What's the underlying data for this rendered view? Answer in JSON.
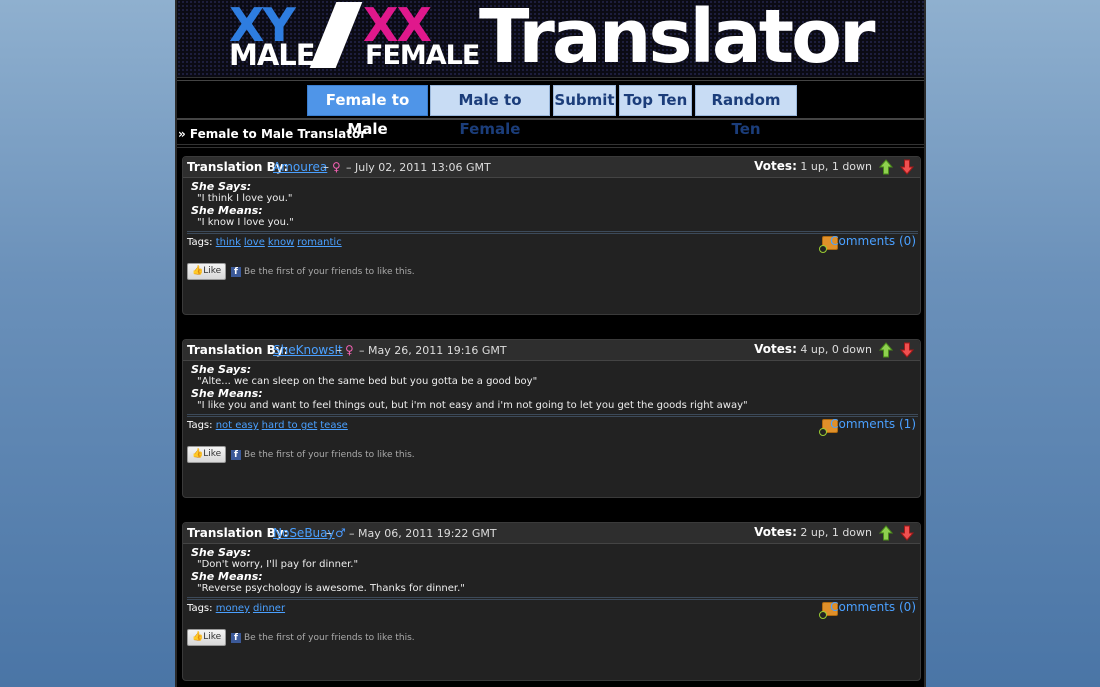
{
  "logo": {
    "xy": "XY",
    "xx": "XX",
    "male": "MALE",
    "female": "FEMALE",
    "translator": "Translator"
  },
  "nav": [
    {
      "label": "Female to Male",
      "active": true
    },
    {
      "label": "Male to Female",
      "active": false
    },
    {
      "label": "Submit",
      "active": false
    },
    {
      "label": "Top Ten",
      "active": false
    },
    {
      "label": "Random Ten",
      "active": false
    }
  ],
  "section_title": "» Female to Male Translator",
  "common": {
    "translation_by": "Translation By:",
    "votes_label": "Votes:",
    "she_says": "She Says:",
    "she_means": "She Means:",
    "tags_label": "Tags:",
    "like_label": "Like",
    "fb_text": "Be the first of your friends to like this.",
    "dash": "–"
  },
  "translations": [
    {
      "author": "Amourea",
      "gender_icon": "female-icon",
      "date": "– July 02, 2011 13:06 GMT",
      "votes": "1 up, 1 down",
      "says": "\"I think I love you.\"",
      "means": "\"I know I love you.\"",
      "tags": [
        "think",
        "love",
        "know",
        "romantic"
      ],
      "comments": "Comments (0)"
    },
    {
      "author": "SheKnowsIt",
      "gender_icon": "female-icon",
      "date": "– May 26, 2011 19:16 GMT",
      "votes": "4 up, 0 down",
      "says": "\"Alte... we can sleep on the same bed but you gotta be a good boy\"",
      "means": "\"I like you and want to feel things out, but i'm not easy and i'm not going to let you get the goods right away\"",
      "tags": [
        "not easy",
        "hard to get",
        "tease"
      ],
      "comments": "Comments (1)"
    },
    {
      "author": "NoSeBuay",
      "gender_icon": "male-icon",
      "date": "– May 06, 2011 19:22 GMT",
      "votes": "2 up, 1 down",
      "says": "\"Don't worry, I'll pay for dinner.\"",
      "means": "\"Reverse psychology is awesome. Thanks for dinner.\"",
      "tags": [
        "money",
        "dinner"
      ],
      "comments": "Comments (0)"
    }
  ]
}
